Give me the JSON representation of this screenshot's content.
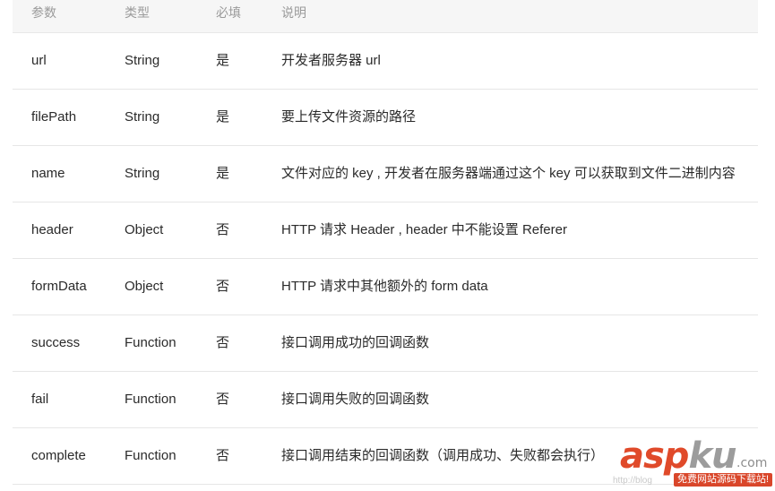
{
  "table": {
    "headers": [
      "参数",
      "类型",
      "必填",
      "说明"
    ],
    "rows": [
      {
        "param": "url",
        "type": "String",
        "required": "是",
        "desc": "开发者服务器 url"
      },
      {
        "param": "filePath",
        "type": "String",
        "required": "是",
        "desc": "要上传文件资源的路径"
      },
      {
        "param": "name",
        "type": "String",
        "required": "是",
        "desc": "文件对应的 key , 开发者在服务器端通过这个 key 可以获取到文件二进制内容"
      },
      {
        "param": "header",
        "type": "Object",
        "required": "否",
        "desc": "HTTP 请求 Header , header 中不能设置 Referer"
      },
      {
        "param": "formData",
        "type": "Object",
        "required": "否",
        "desc": "HTTP 请求中其他额外的 form data"
      },
      {
        "param": "success",
        "type": "Function",
        "required": "否",
        "desc": "接口调用成功的回调函数"
      },
      {
        "param": "fail",
        "type": "Function",
        "required": "否",
        "desc": "接口调用失败的回调函数"
      },
      {
        "param": "complete",
        "type": "Function",
        "required": "否",
        "desc": "接口调用结束的回调函数（调用成功、失败都会执行）"
      }
    ]
  },
  "watermark": {
    "logo_part1": "asp",
    "logo_part2": "ku",
    "domain": ".com",
    "tagline": "免费网站源码下载站!",
    "blog_fragment": "http://blog"
  }
}
